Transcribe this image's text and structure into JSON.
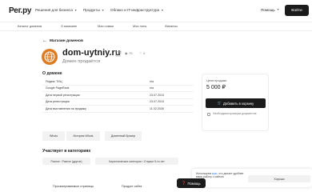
{
  "header": {
    "logo": "Рег.ру",
    "nav": [
      {
        "label": "Решения для бизнеса"
      },
      {
        "label": "Продукты"
      },
      {
        "label": "Облако и IT-инфраструктура"
      }
    ],
    "help_label": "Помощь",
    "login_label": "Войти"
  },
  "subnav": {
    "items": [
      "Каталог доменов",
      "О магазине",
      "Мои ставки",
      "Мои лоты",
      "Финансы"
    ]
  },
  "breadcrumb": {
    "back_label": "Магазин доменов"
  },
  "domain": {
    "name": "dom-uytniy.ru",
    "views": "75",
    "likes": "0",
    "status": "Домен продаётся"
  },
  "about": {
    "title": "О домене",
    "rows": [
      {
        "key": "Яндекс ТИЦ",
        "value": "n/a"
      },
      {
        "key": "Google PageRank",
        "value": "n/a"
      },
      {
        "key": "Дата первой регистрации",
        "value": "23.07.2013"
      },
      {
        "key": "Дата регистрации",
        "value": "23.07.2013"
      },
      {
        "key": "Дата выставления на продажу",
        "value": "11.02.2026"
      }
    ]
  },
  "price": {
    "label": "Цена продажи",
    "value": "5 000 ₽",
    "cart_label": "Добавить в корзину",
    "verify_label": "Необходима проверка документов"
  },
  "tools": [
    {
      "label": "Whois"
    },
    {
      "label": "История Whois"
    },
    {
      "label": "Доменный брокер"
    }
  ],
  "categories": {
    "title": "Участвует в категориях",
    "items": [
      "Разное › Разное (другое)",
      "Кириллические категории › Старше 5-ти лет"
    ]
  },
  "bottom": {
    "left_header": "Просматриваемые страницы",
    "right_header": "Продукт сайта"
  },
  "help_fab": {
    "label": "Помощь"
  },
  "cookie": {
    "text_before": "Используем ",
    "link": "куки",
    "text_after": ", что делает удобнее вашу работу с сайтом",
    "button": "Хорошо"
  },
  "colors": {
    "dark": "#1b1b1b",
    "globe": "#e07a1f",
    "link": "#2f80ed"
  }
}
